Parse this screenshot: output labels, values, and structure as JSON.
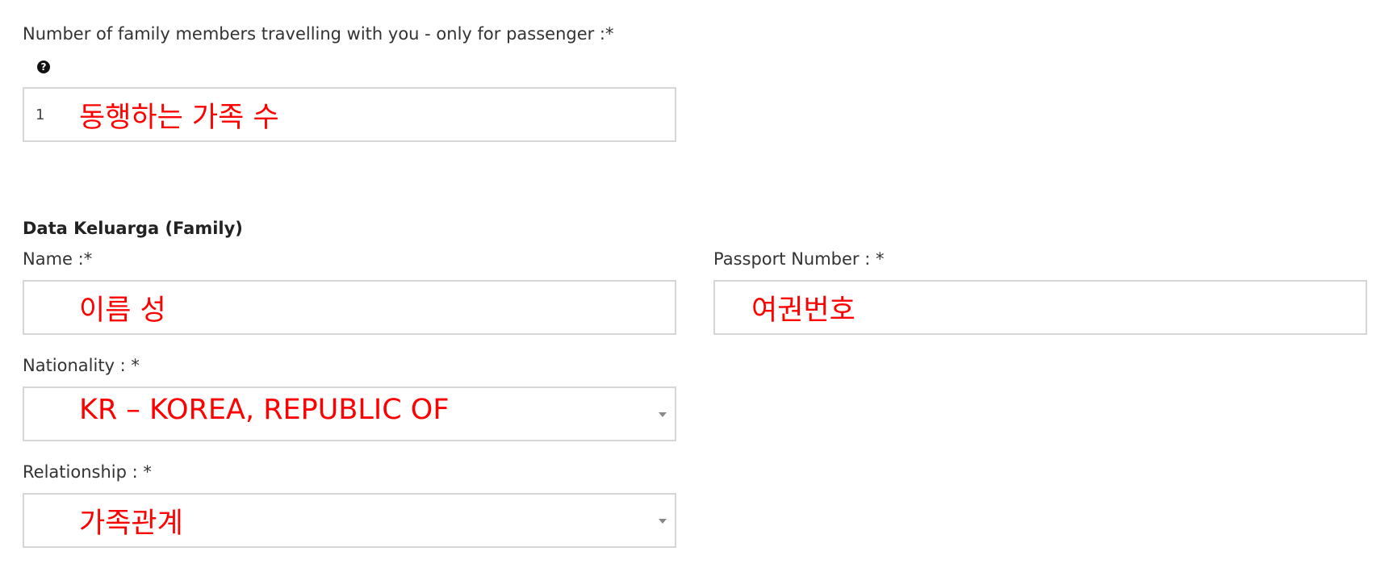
{
  "family_count": {
    "label": "Number of family members travelling with you - only for passenger :*",
    "help_icon": "question-circle-icon",
    "value": "1",
    "annotation": "동행하는 가족 수"
  },
  "section": {
    "title": "Data Keluarga (Family)"
  },
  "name_field": {
    "label": "Name :*",
    "annotation": "이름 성"
  },
  "passport_field": {
    "label": "Passport Number : *",
    "annotation": "여권번호"
  },
  "nationality_field": {
    "label": "Nationality : *",
    "annotation": "KR – KOREA, REPUBLIC OF",
    "caret_icon": "caret-down-icon"
  },
  "relationship_field": {
    "label": "Relationship : *",
    "annotation": "가족관계",
    "caret_icon": "caret-down-icon"
  },
  "colors": {
    "annotation": "#ff0000",
    "border": "#d6d6d6"
  }
}
